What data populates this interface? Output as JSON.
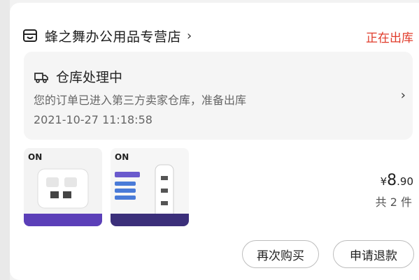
{
  "shop": {
    "name": "蜂之舞办公用品专营店",
    "status": "正在出库"
  },
  "logistics": {
    "title": "仓库处理中",
    "description": "您的订单已进入第三方卖家仓库，准备出库",
    "timestamp": "2021-10-27 11:18:58"
  },
  "products": [
    {
      "brand": "ON"
    },
    {
      "brand": "ON"
    }
  ],
  "price": {
    "currency": "¥",
    "integer": "8",
    "decimal": ".90"
  },
  "quantity_text": "共 2 件",
  "buttons": {
    "rebuy": "再次购买",
    "refund": "申请退款"
  },
  "colors": {
    "status_accent": "#e03b2a",
    "card_bg": "#ffffff",
    "box_bg": "#f5f5f5"
  }
}
